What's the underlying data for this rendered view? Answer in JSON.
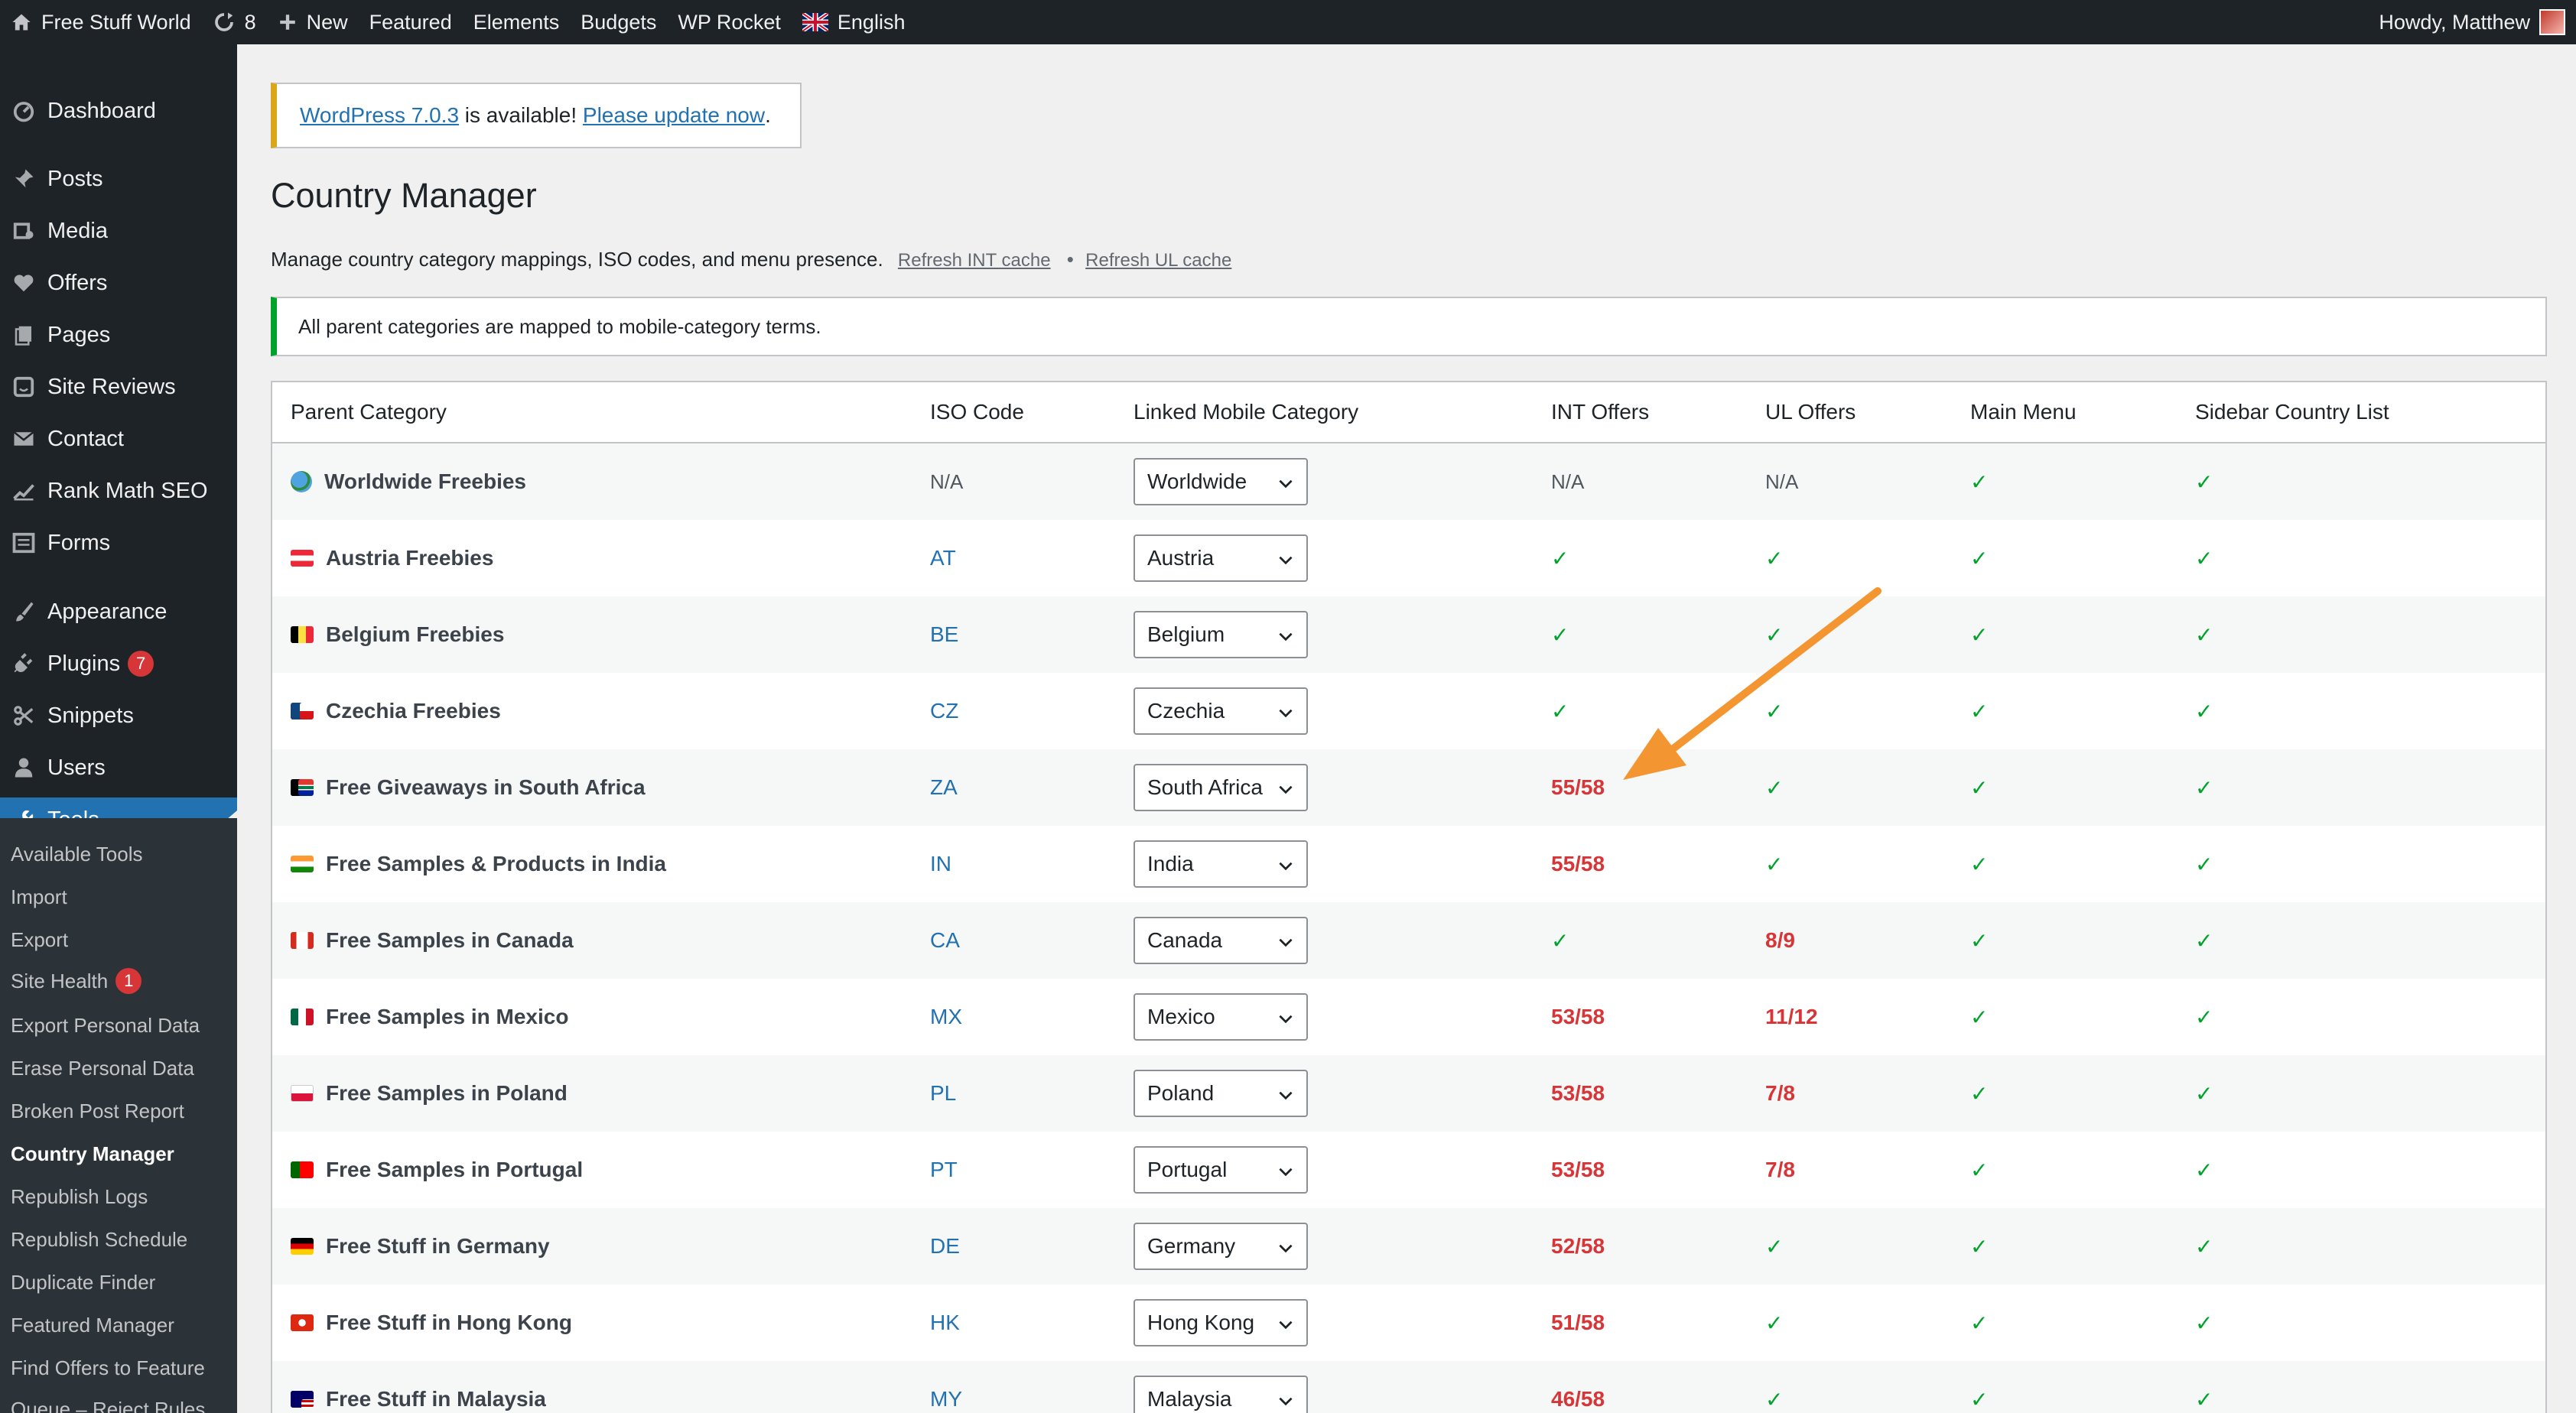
{
  "adminbar": {
    "site_name": "Free Stuff World",
    "updates_count": "8",
    "new_label": "New",
    "items": [
      "Featured",
      "Elements",
      "Budgets",
      "WP Rocket"
    ],
    "language": "English",
    "greeting": "Howdy, Matthew"
  },
  "sidebar": {
    "dashboard": "Dashboard",
    "posts": "Posts",
    "media": "Media",
    "offers": "Offers",
    "pages": "Pages",
    "site_reviews": "Site Reviews",
    "contact": "Contact",
    "rank_math": "Rank Math SEO",
    "forms": "Forms",
    "appearance": "Appearance",
    "plugins": "Plugins",
    "plugins_badge": "7",
    "snippets": "Snippets",
    "users": "Users",
    "tools": "Tools",
    "submenu": {
      "available_tools": "Available Tools",
      "import": "Import",
      "export": "Export",
      "site_health": "Site Health",
      "site_health_badge": "1",
      "export_personal": "Export Personal Data",
      "erase_personal": "Erase Personal Data",
      "broken_post": "Broken Post Report",
      "country_manager": "Country Manager",
      "republish_logs": "Republish Logs",
      "republish_schedule": "Republish Schedule",
      "duplicate_finder": "Duplicate Finder",
      "featured_manager": "Featured Manager",
      "find_offers": "Find Offers to Feature",
      "queue": "Queue – Reject Rules"
    }
  },
  "notice_update": {
    "version_link": "WordPress 7.0.3",
    "middle": " is available! ",
    "update_link": "Please update now",
    "end": "."
  },
  "page": {
    "title": "Country Manager",
    "description": "Manage country category mappings, ISO codes, and menu presence.",
    "refresh_int": "Refresh INT cache",
    "dot": "•",
    "refresh_ul": "Refresh UL cache",
    "success_notice": "All parent categories are mapped to mobile-category terms."
  },
  "table": {
    "headers": [
      "Parent Category",
      "ISO Code",
      "Linked Mobile Category",
      "INT Offers",
      "UL Offers",
      "Main Menu",
      "Sidebar Country List"
    ],
    "rows": [
      {
        "category": "Worldwide Freebies",
        "iso": "N/A",
        "mobile": "Worldwide",
        "int": "N/A",
        "ul": "N/A",
        "main": "✓",
        "sidebar": "✓"
      },
      {
        "category": "Austria Freebies",
        "iso": "AT",
        "mobile": "Austria",
        "int": "✓",
        "ul": "✓",
        "main": "✓",
        "sidebar": "✓"
      },
      {
        "category": "Belgium Freebies",
        "iso": "BE",
        "mobile": "Belgium",
        "int": "✓",
        "ul": "✓",
        "main": "✓",
        "sidebar": "✓"
      },
      {
        "category": "Czechia Freebies",
        "iso": "CZ",
        "mobile": "Czechia",
        "int": "✓",
        "ul": "✓",
        "main": "✓",
        "sidebar": "✓"
      },
      {
        "category": "Free Giveaways in South Africa",
        "iso": "ZA",
        "mobile": "South Africa",
        "int": "55/58",
        "ul": "✓",
        "main": "✓",
        "sidebar": "✓"
      },
      {
        "category": "Free Samples & Products in India",
        "iso": "IN",
        "mobile": "India",
        "int": "55/58",
        "ul": "✓",
        "main": "✓",
        "sidebar": "✓"
      },
      {
        "category": "Free Samples in Canada",
        "iso": "CA",
        "mobile": "Canada",
        "int": "✓",
        "ul": "8/9",
        "main": "✓",
        "sidebar": "✓"
      },
      {
        "category": "Free Samples in Mexico",
        "iso": "MX",
        "mobile": "Mexico",
        "int": "53/58",
        "ul": "11/12",
        "main": "✓",
        "sidebar": "✓"
      },
      {
        "category": "Free Samples in Poland",
        "iso": "PL",
        "mobile": "Poland",
        "int": "53/58",
        "ul": "7/8",
        "main": "✓",
        "sidebar": "✓"
      },
      {
        "category": "Free Samples in Portugal",
        "iso": "PT",
        "mobile": "Portugal",
        "int": "53/58",
        "ul": "7/8",
        "main": "✓",
        "sidebar": "✓"
      },
      {
        "category": "Free Stuff in Germany",
        "iso": "DE",
        "mobile": "Germany",
        "int": "52/58",
        "ul": "✓",
        "main": "✓",
        "sidebar": "✓"
      },
      {
        "category": "Free Stuff in Hong Kong",
        "iso": "HK",
        "mobile": "Hong Kong",
        "int": "51/58",
        "ul": "✓",
        "main": "✓",
        "sidebar": "✓"
      },
      {
        "category": "Free Stuff in Malaysia",
        "iso": "MY",
        "mobile": "Malaysia",
        "int": "46/58",
        "ul": "✓",
        "main": "✓",
        "sidebar": "✓"
      }
    ]
  },
  "colors": {
    "admin_dark": "#1d2327",
    "accent_blue": "#2271b1",
    "success_green": "#00a32a",
    "warning_red": "#d63638",
    "annotation_orange": "#f39530"
  }
}
